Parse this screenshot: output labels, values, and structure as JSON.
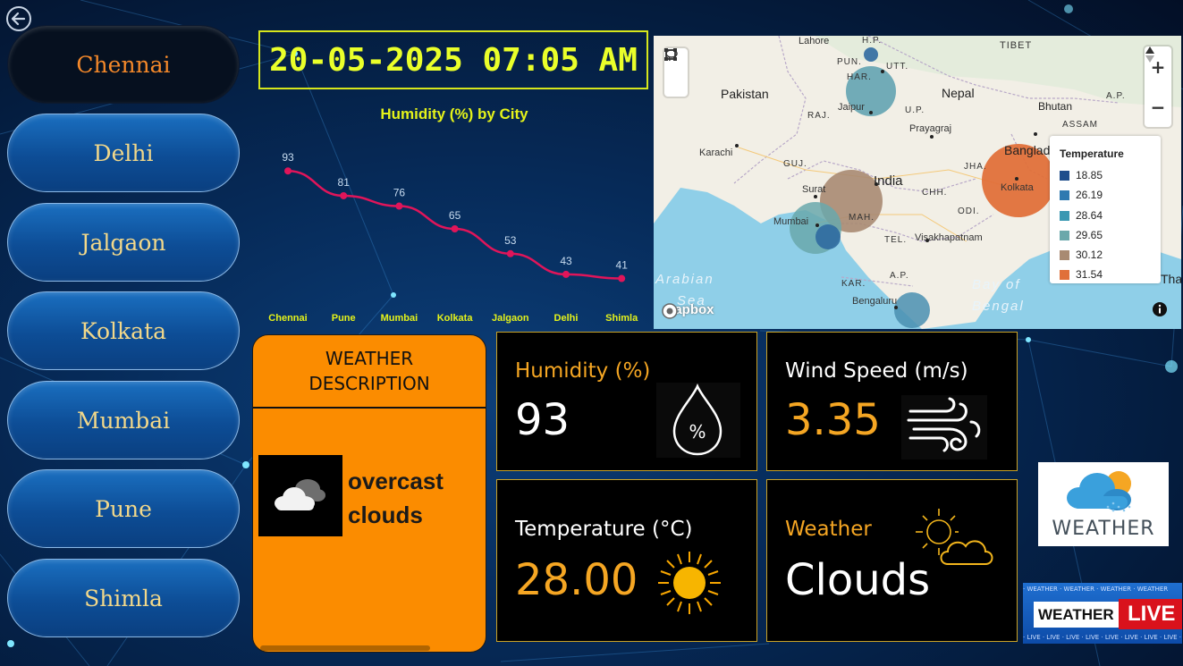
{
  "cities": [
    "Chennai",
    "Delhi",
    "Jalgaon",
    "Kolkata",
    "Mumbai",
    "Pune",
    "Shimla"
  ],
  "selected_city": "Chennai",
  "datetime": "20-05-2025 07:05 AM",
  "chart_data": {
    "type": "line",
    "title": "Humidity (%) by City",
    "categories": [
      "Chennai",
      "Pune",
      "Mumbai",
      "Kolkata",
      "Jalgaon",
      "Delhi",
      "Shimla"
    ],
    "values": [
      93,
      81,
      76,
      65,
      53,
      43,
      41
    ],
    "color": "#e0155a",
    "ylim": [
      30,
      100
    ]
  },
  "map": {
    "labels": {
      "lahore": "Lahore",
      "hp": "H.P.",
      "tibet": "TIBET",
      "pun": "PUN.",
      "utt": "UTT.",
      "pakistan": "Pakistan",
      "har": "HAR.",
      "nepal": "Nepal",
      "ap_top": "A.P.",
      "jaipur": "Jaipur",
      "raj": "RAJ.",
      "up": "U.P.",
      "bhutan": "Bhutan",
      "assam": "ASSAM",
      "prayagraj": "Prayagraj",
      "karachi": "Karachi",
      "bangla": "Banglad",
      "guj": "GUJ.",
      "jha": "JHA.",
      "india": "India",
      "surat": "Surat",
      "kolkata": "Kolkata",
      "chh": "CHH.",
      "mah": "MAH.",
      "mumbai": "Mumbai",
      "odi": "ODI.",
      "tel": "TEL.",
      "visakhapatnam": "Visakhapatnam",
      "arabian": "Arabian",
      "sea": "Sea",
      "kar": "KAR.",
      "ap_south": "A.P.",
      "bay_of": "Bay of",
      "bengal": "Bengal",
      "bengaluru": "Bengaluru",
      "tha": "Tha",
      "mapbox": "mapbox"
    },
    "legend": {
      "title": "Temperature",
      "items": [
        {
          "value": "18.85",
          "color": "#1f4e8c"
        },
        {
          "value": "26.19",
          "color": "#2f7ab0"
        },
        {
          "value": "28.64",
          "color": "#3a98b2"
        },
        {
          "value": "29.65",
          "color": "#6aa8ab"
        },
        {
          "value": "30.12",
          "color": "#a88a72"
        },
        {
          "value": "31.54",
          "color": "#e0703a"
        }
      ]
    }
  },
  "weather_description": {
    "header_line1": "WEATHER",
    "header_line2": "DESCRIPTION",
    "line1": "overcast",
    "line2": "clouds",
    "icon": "cloud-icon"
  },
  "cards": {
    "humidity": {
      "label": "Humidity (%)",
      "value": "93",
      "icon": "humidity-drop-icon"
    },
    "wind": {
      "label": "Wind Speed (m/s)",
      "value": "3.35",
      "icon": "wind-icon"
    },
    "temperature": {
      "label": "Temperature (°C)",
      "value": "28.00",
      "icon": "sun-icon"
    },
    "weather": {
      "label": "Weather",
      "value": "Clouds",
      "icon": "partly-cloudy-icon"
    }
  },
  "logos": {
    "weather_logo_text": "WEATHER",
    "live_weather": "WEATHER",
    "live_live": "LIVE",
    "strip_top": "· WEATHER · WEATHER · WEATHER · WEATHER",
    "strip_bottom": "· LIVE · LIVE · LIVE · LIVE · LIVE · LIVE · LIVE · LIVE · LIVE · LIVE · LIVE"
  },
  "colors": {
    "accent_orange": "#fb8c00",
    "datetime_yellow": "#eaff2a",
    "card_value_orange": "#f5a623"
  }
}
